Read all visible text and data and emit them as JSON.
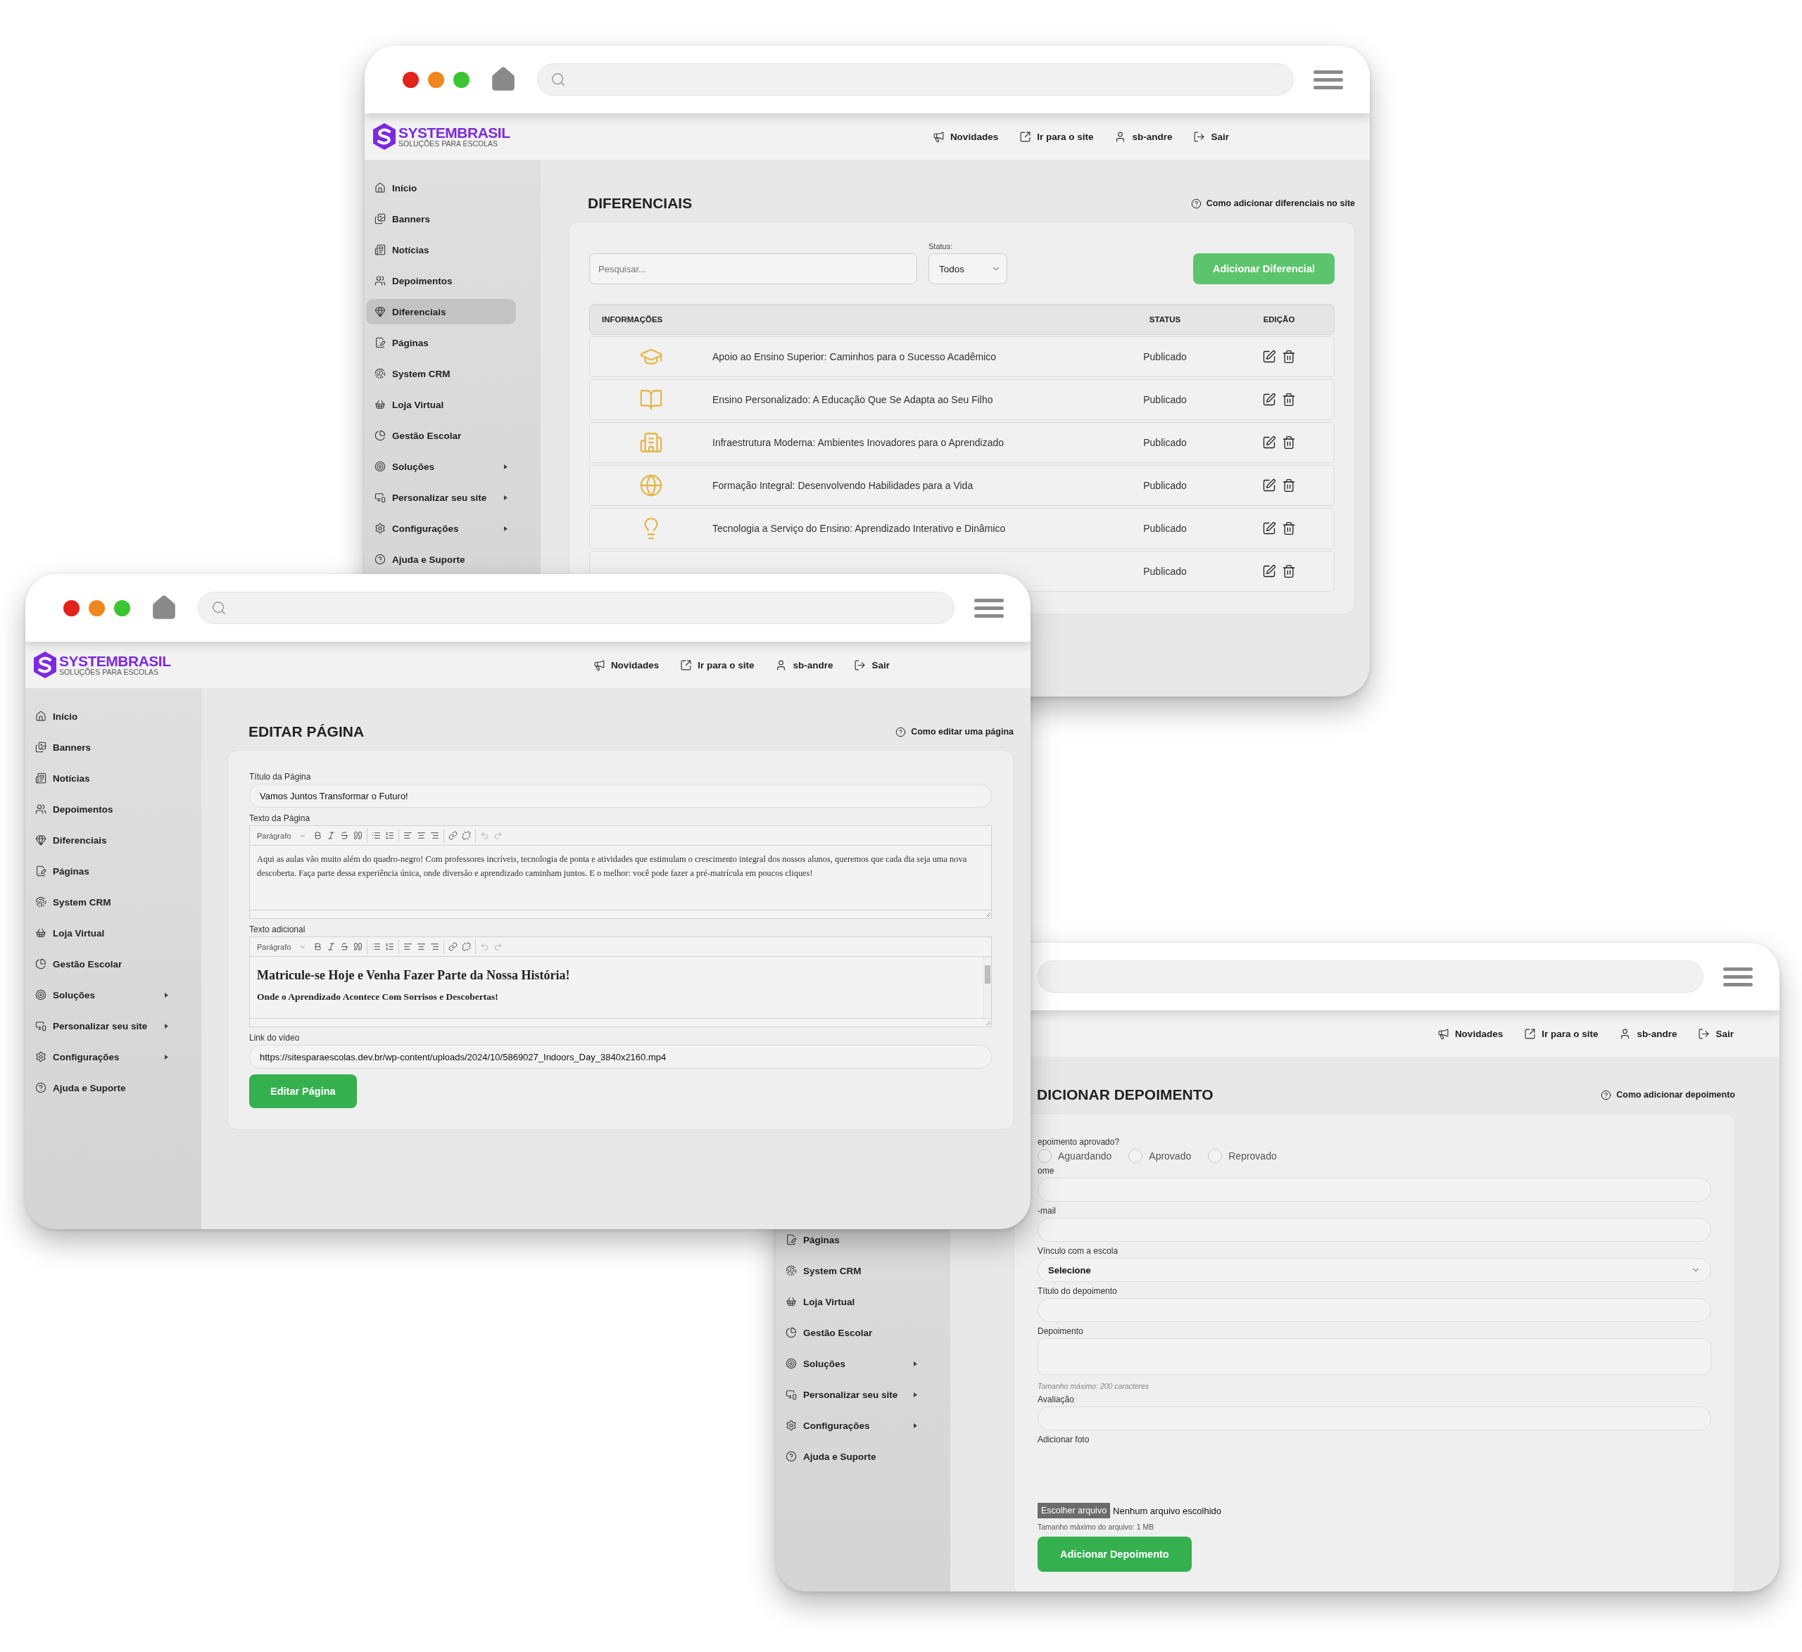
{
  "windows": [
    {
      "kind": "list",
      "controls_visible": true,
      "brand": {
        "name": "SYSTEMBRASIL",
        "tagline": "SOLUÇÕES PARA ESCOLAS"
      },
      "nav": [
        "Novidades",
        "Ir para o site",
        "sb-andre",
        "Sair"
      ],
      "sidebar": [
        {
          "label": "Início",
          "submenu": false,
          "selected": false
        },
        {
          "label": "Banners",
          "submenu": false,
          "selected": false
        },
        {
          "label": "Notícias",
          "submenu": false,
          "selected": false
        },
        {
          "label": "Depoimentos",
          "submenu": false,
          "selected": false
        },
        {
          "label": "Diferenciais",
          "submenu": false,
          "selected": true
        },
        {
          "label": "Páginas",
          "submenu": false,
          "selected": false
        },
        {
          "label": "System CRM",
          "submenu": false,
          "selected": false
        },
        {
          "label": "Loja Virtual",
          "submenu": false,
          "selected": false
        },
        {
          "label": "Gestão Escolar",
          "submenu": false,
          "selected": false
        },
        {
          "label": "Soluções",
          "submenu": true,
          "selected": false
        },
        {
          "label": "Personalizar seu site",
          "submenu": true,
          "selected": false
        },
        {
          "label": "Configurações",
          "submenu": true,
          "selected": false
        },
        {
          "label": "Ajuda e Suporte",
          "submenu": false,
          "selected": false
        }
      ],
      "title": "DIFERENCIAIS",
      "help": "Como adicionar diferenciais no site",
      "search": {
        "placeholder": "Pesquisar..."
      },
      "status_filter": {
        "label": "Status:",
        "value": "Todos"
      },
      "add_button": "Adicionar Diferencial",
      "table": {
        "columns": [
          "INFORMAÇÕES",
          "STATUS",
          "EDIÇÃO"
        ],
        "rows": [
          {
            "title": "Apoio ao Ensino Superior: Caminhos para o Sucesso Acadêmico",
            "status": "Publicado"
          },
          {
            "title": "Ensino Personalizado: A Educação Que Se Adapta ao Seu Filho",
            "status": "Publicado"
          },
          {
            "title": "Infraestrutura Moderna: Ambientes Inovadores para o Aprendizado",
            "status": "Publicado"
          },
          {
            "title": "Formação Integral: Desenvolvendo Habilidades para a Vida",
            "status": "Publicado"
          },
          {
            "title": "Tecnologia a Serviço do Ensino: Aprendizado Interativo e Dinâmico",
            "status": "Publicado"
          },
          {
            "status": "Publicado"
          }
        ]
      }
    },
    {
      "kind": "edit",
      "controls_visible": true,
      "brand": {
        "name": "SYSTEMBRASIL",
        "tagline": "SOLUÇÕES PARA ESCOLAS"
      },
      "nav": [
        "Novidades",
        "Ir para o site",
        "sb-andre",
        "Sair"
      ],
      "sidebar": [
        {
          "label": "Início",
          "submenu": false,
          "selected": false
        },
        {
          "label": "Banners",
          "submenu": false,
          "selected": false
        },
        {
          "label": "Notícias",
          "submenu": false,
          "selected": false
        },
        {
          "label": "Depoimentos",
          "submenu": false,
          "selected": false
        },
        {
          "label": "Diferenciais",
          "submenu": false,
          "selected": false
        },
        {
          "label": "Páginas",
          "submenu": false,
          "selected": false
        },
        {
          "label": "System CRM",
          "submenu": false,
          "selected": false
        },
        {
          "label": "Loja Virtual",
          "submenu": false,
          "selected": false
        },
        {
          "label": "Gestão Escolar",
          "submenu": false,
          "selected": false
        },
        {
          "label": "Soluções",
          "submenu": true,
          "selected": false
        },
        {
          "label": "Personalizar seu site",
          "submenu": true,
          "selected": false
        },
        {
          "label": "Configurações",
          "submenu": true,
          "selected": false
        },
        {
          "label": "Ajuda e Suporte",
          "submenu": false,
          "selected": false
        }
      ],
      "title": "EDITAR PÁGINA",
      "help": "Como editar uma página",
      "fields": [
        {
          "kind": "text",
          "label": "Título da Página",
          "value": "Vamos Juntos Transformar o Futuro!"
        },
        {
          "kind": "editor",
          "label": "Texto da Página",
          "format": "Parágrafo",
          "scrollbar": false,
          "content": [
            {
              "kind": "paragraph",
              "text": "Aqui as aulas vão muito além do quadro-negro! Com professores incríveis, tecnologia de ponta e atividades que estimulam o crescimento integral dos nossos alunos, queremos que cada dia seja uma nova descoberta. Faça parte dessa experiência única, onde diversão e aprendizado caminham juntos. E o melhor: você pode fazer a pré-matrícula em poucos cliques!"
            }
          ]
        },
        {
          "kind": "editor",
          "label": "Texto adicional",
          "format": "Parágrafo",
          "scrollbar": true,
          "content": [
            {
              "kind": "heading",
              "text": "Matricule-se Hoje e Venha Fazer Parte da Nossa História!"
            },
            {
              "kind": "subheading",
              "text": "Onde o Aprendizado Acontece Com Sorrisos e Descobertas!"
            }
          ]
        },
        {
          "kind": "text",
          "label": "Link do vídeo",
          "value": "https://sitesparaescolas.dev.br/wp-content/uploads/2024/10/5869027_Indoors_Day_3840x2160.mp4"
        }
      ],
      "submit": "Editar Página"
    },
    {
      "kind": "form",
      "controls_visible": false,
      "nav": [
        "Novidades",
        "Ir para o site",
        "sb-andre",
        "Sair"
      ],
      "sidebar": [
        {
          "label": "Páginas",
          "submenu": false,
          "selected": false
        },
        {
          "label": "System CRM",
          "submenu": false,
          "selected": false
        },
        {
          "label": "Loja Virtual",
          "submenu": false,
          "selected": false
        },
        {
          "label": "Gestão Escolar",
          "submenu": false,
          "selected": false
        },
        {
          "label": "Soluções",
          "submenu": true,
          "selected": false
        },
        {
          "label": "Personalizar seu site",
          "submenu": true,
          "selected": false
        },
        {
          "label": "Configurações",
          "submenu": true,
          "selected": false
        },
        {
          "label": "Ajuda e Suporte",
          "submenu": false,
          "selected": false
        }
      ],
      "title": "DICIONAR DEPOIMENTO",
      "help": "Como adicionar depoimento",
      "fields": [
        {
          "kind": "radio",
          "label": "epoimento aprovado?",
          "options": [
            {
              "label": "Aguardando",
              "selected": false
            },
            {
              "label": "Aprovado",
              "selected": false
            },
            {
              "label": "Reprovado",
              "selected": false
            }
          ]
        },
        {
          "kind": "text",
          "label": "ome"
        },
        {
          "kind": "text",
          "label": "-mail"
        },
        {
          "kind": "select",
          "label": "Vínculo com a escola",
          "value": "Selecione"
        },
        {
          "kind": "text",
          "label": "Título do depoimento"
        },
        {
          "kind": "textarea",
          "label": "Depoimento",
          "hint": "Tamanho máximo: 200 caracteres"
        },
        {
          "kind": "text",
          "label": "Avaliação"
        },
        {
          "kind": "file",
          "label": "Adicionar foto",
          "button": "Escolher arquivo",
          "status": "Nenhum arquivo escolhido",
          "hint": "Tamanho máximo do arquivo: 1 MB"
        }
      ],
      "submit": "Adicionar Depoimento"
    }
  ]
}
